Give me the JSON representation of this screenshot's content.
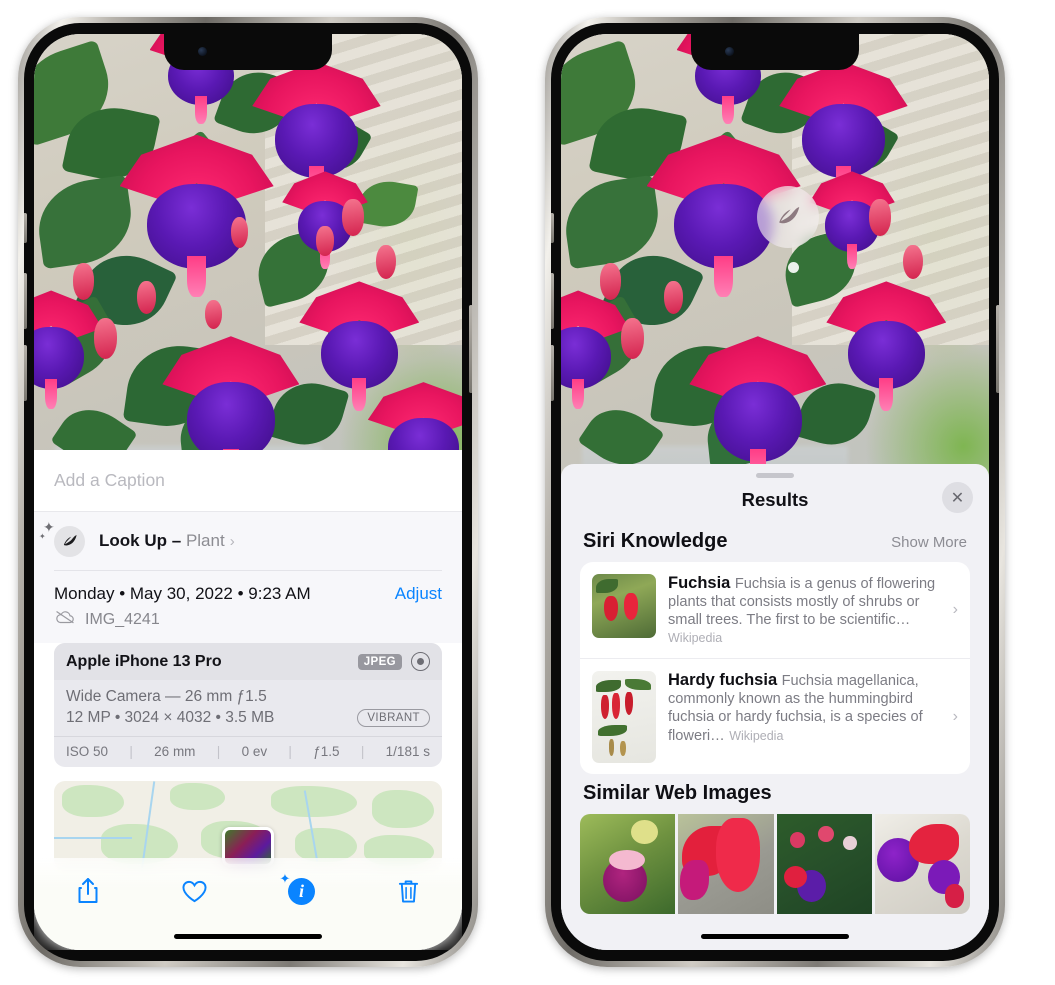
{
  "app": {
    "name": "Photos",
    "platform": "iOS",
    "device": "iPhone 13 Pro"
  },
  "left_phone": {
    "caption": {
      "placeholder": "Add a Caption",
      "value": ""
    },
    "lookup_row": {
      "icon": "leaf-icon",
      "label": "Look Up",
      "separator": "–",
      "kind": "Plant",
      "chevron": "›"
    },
    "meta": {
      "date": "Monday • May 30, 2022 • 9:23 AM",
      "adjust_label": "Adjust",
      "cloud_icon": "cloud-slash-icon",
      "filename": "IMG_4241"
    },
    "camera_card": {
      "model": "Apple iPhone 13 Pro",
      "format_badge": "JPEG",
      "aperture_icon": "aperture-icon",
      "lens": "Wide Camera — 26 mm ƒ1.5",
      "resolution": "12 MP • 3024 × 4032 • 3.5 MB",
      "style_badge": "VIBRANT",
      "exif": [
        "ISO 50",
        "26 mm",
        "0 ev",
        "ƒ1.5",
        "1/181 s"
      ],
      "exif_divider": "|"
    },
    "toolbar": [
      {
        "name": "share-icon",
        "glyph": "share"
      },
      {
        "name": "favorite-heart-icon",
        "glyph": "heart"
      },
      {
        "name": "info-icon",
        "glyph": "info",
        "active": true,
        "label": "i"
      },
      {
        "name": "trash-icon",
        "glyph": "trash"
      }
    ]
  },
  "right_phone": {
    "visual_lookup_badge": {
      "icon": "leaf-icon"
    },
    "sheet": {
      "title": "Results",
      "close_label": "✕",
      "sections": [
        {
          "title": "Siri Knowledge",
          "action": "Show More",
          "items": [
            {
              "title": "Fuchsia",
              "description": "Fuchsia is a genus of flowering plants that consists mostly of shrubs or small trees. The first to be scientific…",
              "source": "Wikipedia",
              "chevron": "›"
            },
            {
              "title": "Hardy fuchsia",
              "description": "Fuchsia magellanica, commonly known as the hummingbird fuchsia or hardy fuchsia, is a species of floweri…",
              "source": "Wikipedia",
              "chevron": "›"
            }
          ]
        },
        {
          "title": "Similar Web Images",
          "action": "",
          "tiles": [
            "web-image-1",
            "web-image-2",
            "web-image-3",
            "web-image-4"
          ]
        }
      ]
    }
  },
  "colors": {
    "accent_blue": "#0a84ff",
    "sheet_bg": "#f1f1f5",
    "card_bg": "#ffffff",
    "meta_bg": "#f7f7fa",
    "camera_card_bg": "#e9e9ee",
    "secondary_text": "#8c8c92"
  }
}
